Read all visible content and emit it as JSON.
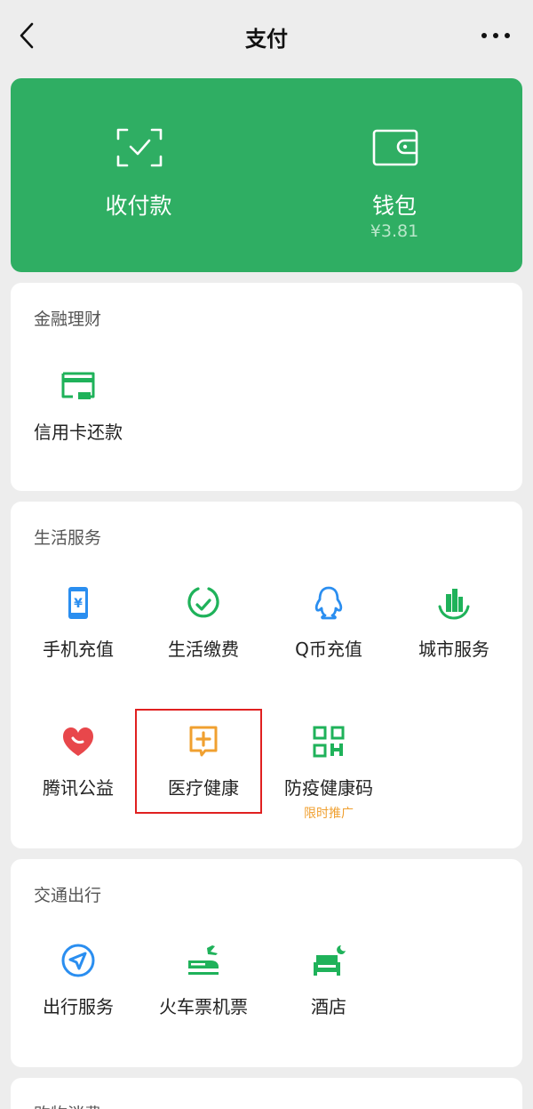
{
  "nav": {
    "title": "支付"
  },
  "hero": {
    "left": {
      "label": "收付款"
    },
    "right": {
      "label": "钱包",
      "balance": "¥3.81"
    }
  },
  "finance": {
    "title": "金融理财",
    "items": [
      {
        "label": "信用卡还款",
        "icon": "credit-card-icon"
      }
    ]
  },
  "life": {
    "title": "生活服务",
    "items": [
      {
        "label": "手机充值",
        "icon": "phone-recharge-icon"
      },
      {
        "label": "生活缴费",
        "icon": "utility-bill-icon"
      },
      {
        "label": "Q币充值",
        "icon": "qq-coin-icon"
      },
      {
        "label": "城市服务",
        "icon": "city-service-icon"
      },
      {
        "label": "腾讯公益",
        "icon": "charity-heart-icon"
      },
      {
        "label": "医疗健康",
        "icon": "medical-health-icon"
      },
      {
        "label": "防疫健康码",
        "icon": "health-qr-code-icon",
        "badge": "限时推广"
      }
    ]
  },
  "transport": {
    "title": "交通出行",
    "items": [
      {
        "label": "出行服务",
        "icon": "travel-navigation-icon"
      },
      {
        "label": "火车票机票",
        "icon": "train-plane-ticket-icon"
      },
      {
        "label": "酒店",
        "icon": "hotel-bed-icon"
      }
    ]
  },
  "shopping": {
    "title": "购物消费"
  },
  "colors": {
    "brand_green": "#2fae63",
    "icon_green": "#1fb25a",
    "icon_blue": "#2a8ef0",
    "icon_orange": "#f0a030",
    "icon_red": "#e8474b",
    "highlight_red": "#e02020"
  }
}
